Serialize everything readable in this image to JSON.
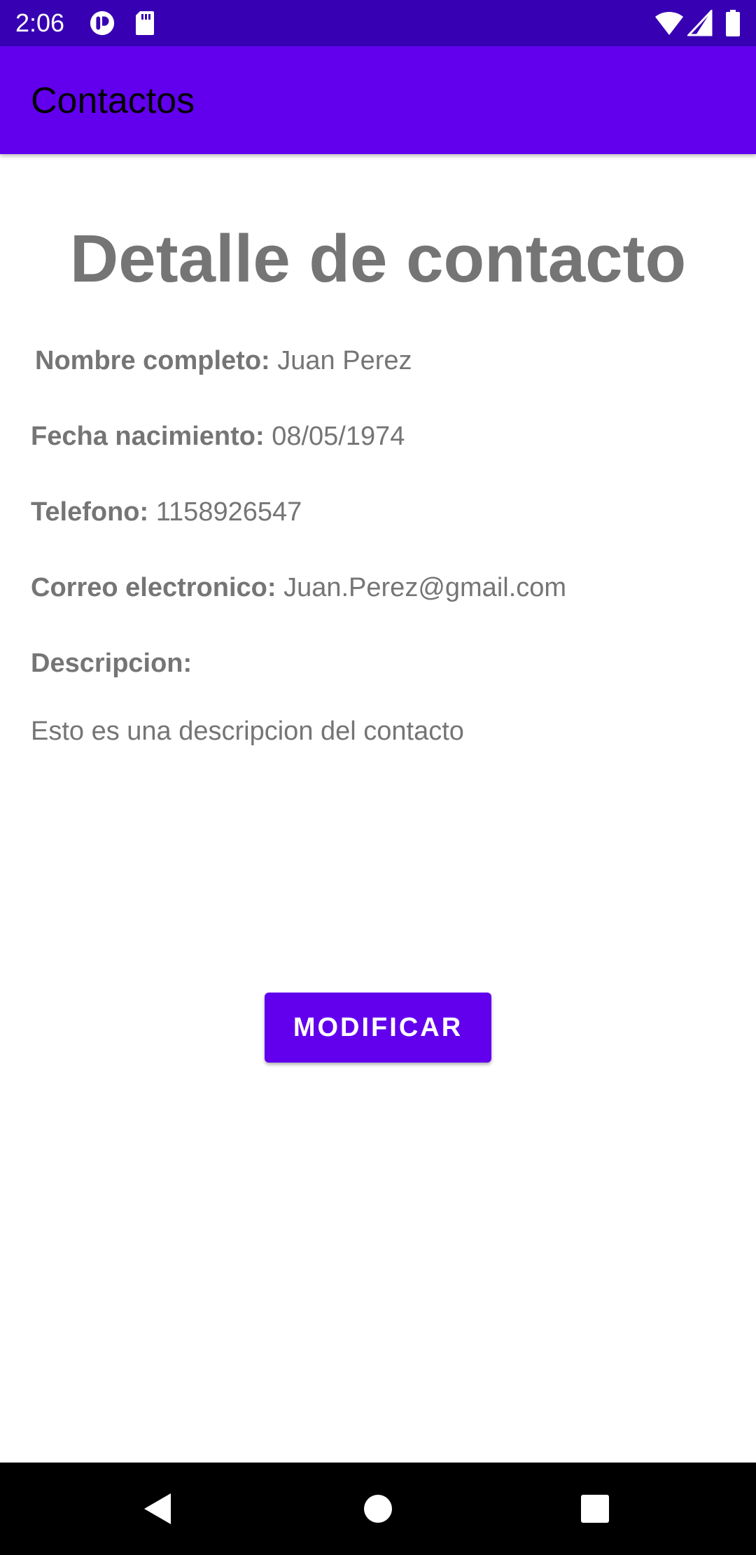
{
  "status_bar": {
    "time": "2:06",
    "icons": [
      "app-notification-icon",
      "sd-card-icon",
      "wifi-icon",
      "cellular-signal-icon",
      "battery-icon"
    ]
  },
  "app_bar": {
    "title": "Contactos"
  },
  "main": {
    "title": "Detalle de contacto",
    "fields": {
      "full_name": {
        "label": "Nombre completo:",
        "value": "Juan Perez"
      },
      "birth_date": {
        "label": "Fecha nacimiento:",
        "value": "08/05/1974"
      },
      "phone": {
        "label": "Telefono:",
        "value": "1158926547"
      },
      "email": {
        "label": "Correo electronico:",
        "value": "Juan.Perez@gmail.com"
      },
      "description": {
        "label": "Descripcion:",
        "value": "Esto es una descripcion del contacto"
      }
    },
    "modify_button": "MODIFICAR"
  },
  "nav_bar": {
    "icons": [
      "back-icon",
      "home-icon",
      "recents-icon"
    ]
  },
  "colors": {
    "status_bar": "#3700b3",
    "primary": "#6200ee",
    "text_gray": "#757575"
  }
}
